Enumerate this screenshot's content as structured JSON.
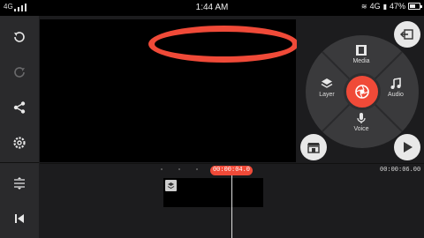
{
  "status_bar": {
    "network": "4G",
    "time": "1:44 AM",
    "right_network": "4G",
    "battery": "47%"
  },
  "left_toolbar": {
    "items": [
      {
        "icon": "undo-icon"
      },
      {
        "icon": "redo-icon"
      },
      {
        "icon": "share-icon"
      },
      {
        "icon": "settings-icon"
      },
      {
        "icon": "timeline-adjust-icon"
      },
      {
        "icon": "skip-to-start-icon"
      }
    ]
  },
  "media_wheel": {
    "items": [
      {
        "label": "Media",
        "icon": "film-icon"
      },
      {
        "label": "Layer",
        "icon": "layers-icon"
      },
      {
        "label": "Audio",
        "icon": "music-note-icon"
      },
      {
        "label": "Voice",
        "icon": "microphone-icon"
      }
    ],
    "center_icon": "camera-shutter-icon",
    "accent_color": "#f04a38"
  },
  "timeline": {
    "current_time": "00:00:04.0",
    "total_time": "00:00:06.00"
  },
  "annotation": {
    "shape": "ellipse",
    "color": "#f04a38"
  }
}
